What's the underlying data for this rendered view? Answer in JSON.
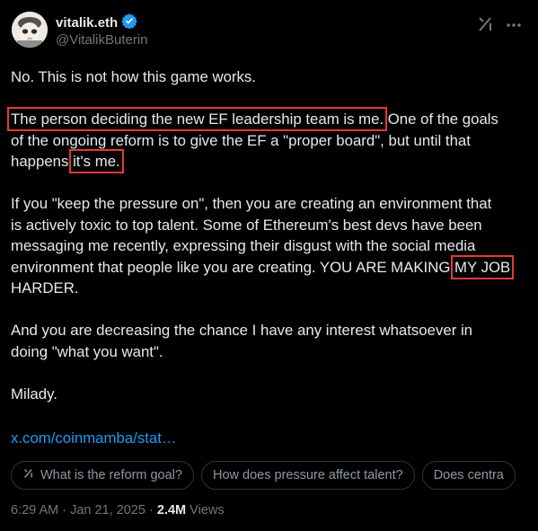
{
  "author": {
    "display_name": "vitalik.eth",
    "handle": "@VitalikButerin",
    "verified_color": "#1d9bf0"
  },
  "header_icons": [
    "grok-icon",
    "more-icon"
  ],
  "post": {
    "line1": "No. This is not how this game works.",
    "p2_highlight1": "The person deciding the new EF leadership team is me.",
    "p2_rest1": " One of the goals",
    "p2_line2": "of the ongoing reform is to give the EF a \"proper board\", but until that",
    "p2_line3_pre": "happens ",
    "p2_highlight2": "it's me.",
    "p3_line1": "If you \"keep the pressure on\", then you are creating an environment that",
    "p3_line2": "is actively toxic to top talent. Some of Ethereum's best devs have been",
    "p3_line3": "messaging me recently, expressing their disgust with the social media",
    "p3_line4_pre": "environment that people like you are creating. YOU ARE MAKING ",
    "p3_highlight3": "MY JOB",
    "p3_line5": "HARDER.",
    "p4_line1": "And you are decreasing the chance I have any interest whatsoever in",
    "p4_line2": "doing \"what you want\".",
    "p5": "Milady."
  },
  "link_text": "x.com/coinmamba/stat…",
  "chips": [
    {
      "label": "What is the reform goal?",
      "icon": "grok-icon"
    },
    {
      "label": "How does pressure affect talent?"
    },
    {
      "label": "Does centra"
    }
  ],
  "meta": {
    "time": "6:29 AM",
    "separator": "·",
    "date": "Jan 21, 2025",
    "views_count": "2.4M",
    "views_label": "Views"
  },
  "colors": {
    "background": "#000000",
    "text": "#e7e9ea",
    "secondary": "#71767b",
    "link": "#1d9bf0",
    "highlight_box": "#e53935"
  }
}
